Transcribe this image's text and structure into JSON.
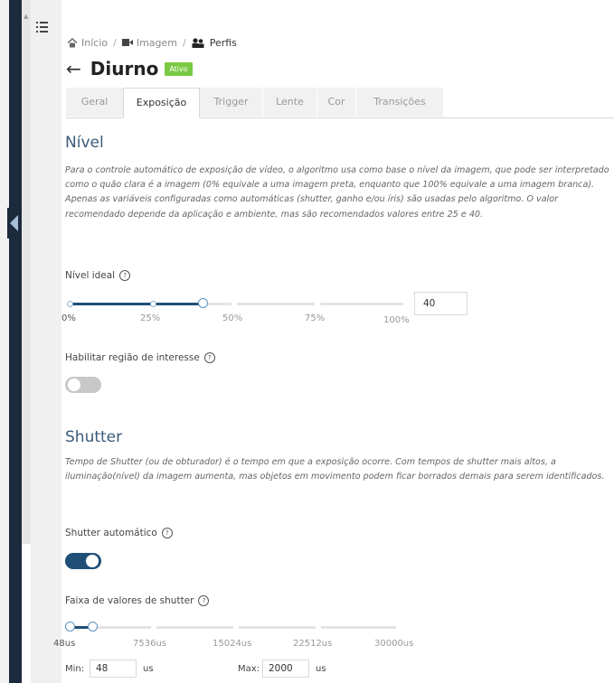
{
  "breadcrumb": {
    "home": "Início",
    "image": "Imagem",
    "profiles": "Perfis"
  },
  "page": {
    "title": "Diurno",
    "badge": "Ativo"
  },
  "tabs": [
    "Geral",
    "Exposição",
    "Trigger",
    "Lente",
    "Cor",
    "Transições"
  ],
  "active_tab": "Exposição",
  "nivel": {
    "title": "Nível",
    "description": "Para o controle automático de exposição de vídeo, o algoritmo usa como base o nível da imagem, que pode ser interpretado como o quão clara é a imagem (0% equivale a uma imagem preta, enquanto que 100% equivale a uma imagem branca). Apenas as variáveis configuradas como automáticas (shutter, ganho e/ou íris) são usadas pelo algoritmo. O valor recomendado depende da aplicação e ambiente, mas são recomendados valores entre 25 e 40.",
    "ideal_label": "Nível ideal",
    "ideal_value": "40",
    "ideal_fraction": 0.4,
    "slider_ticks": [
      "0%",
      "25%",
      "50%",
      "75%",
      "100%"
    ],
    "roi_label": "Habilitar região de interesse",
    "roi_enabled": false
  },
  "shutter": {
    "title": "Shutter",
    "description": "Tempo de Shutter (ou de obturador) é o tempo em que a exposição ocorre. Com tempos de shutter mais altos, a iluminação(nível) da imagem aumenta, mas objetos em movimento podem ficar borrados demais para serem identificados.",
    "auto_label": "Shutter automático",
    "auto_enabled": true,
    "range_label": "Faixa de valores de shutter",
    "range_ticks": [
      "48us",
      "7536us",
      "15024us",
      "22512us",
      "30000us"
    ],
    "range_min_us": 48,
    "range_max_us": 2000,
    "min_label": "Min:",
    "min_value": "48",
    "max_label": "Max:",
    "max_value": "2000",
    "unit": "us"
  },
  "colors": {
    "accent": "#1f4f77",
    "heading": "#3b5b7a",
    "badge": "#7ac943",
    "nav": "#1b2a3c"
  },
  "icons": [
    "menu-icon",
    "home-icon",
    "camera-icon",
    "profiles-icon",
    "back-arrow-icon",
    "help-icon",
    "collapse-chevron-icon"
  ]
}
